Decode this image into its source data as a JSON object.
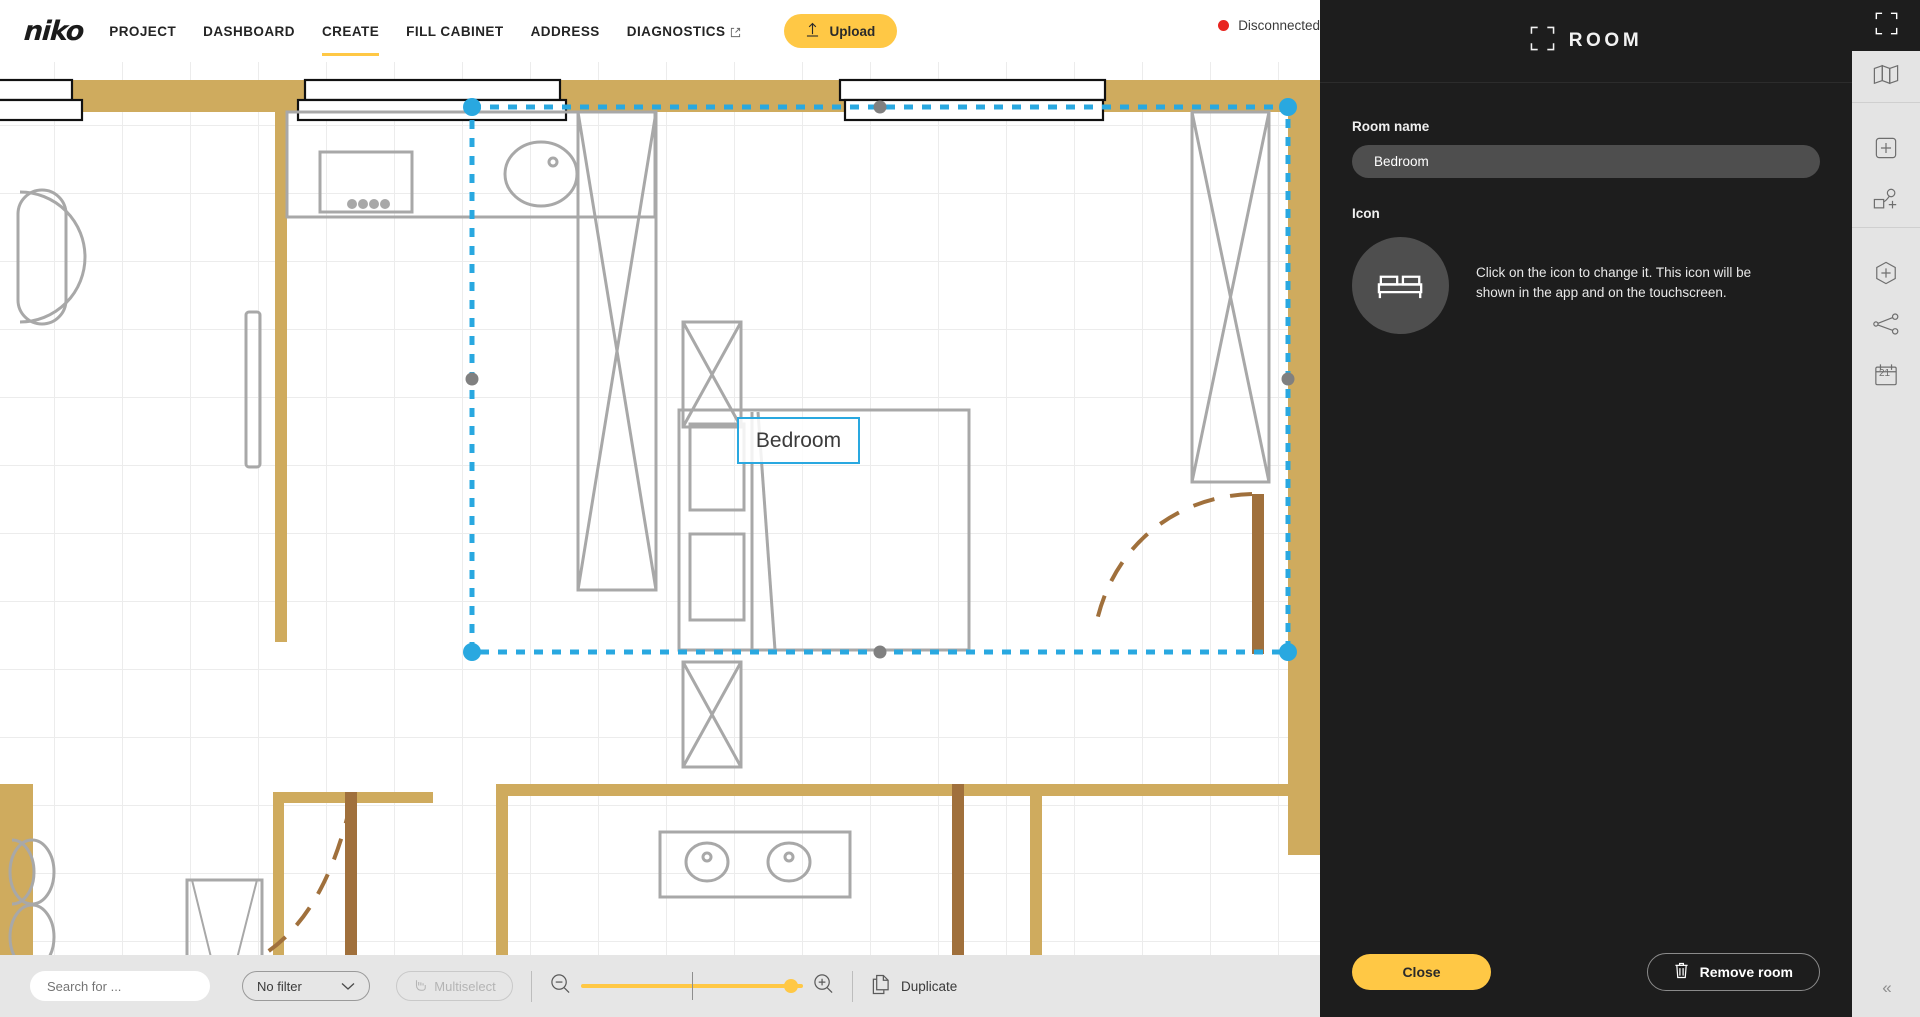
{
  "brand": {
    "logo": "niko"
  },
  "topnav": {
    "items": [
      {
        "label": "PROJECT",
        "active": false,
        "external": false
      },
      {
        "label": "DASHBOARD",
        "active": false,
        "external": false
      },
      {
        "label": "CREATE",
        "active": true,
        "external": false
      },
      {
        "label": "FILL CABINET",
        "active": false,
        "external": false
      },
      {
        "label": "ADDRESS",
        "active": false,
        "external": false
      },
      {
        "label": "DIAGNOSTICS",
        "active": false,
        "external": true
      }
    ],
    "upload_label": "Upload",
    "status_label": "Disconnected",
    "status_color": "#e8241f"
  },
  "canvas": {
    "room_label": "Bedroom",
    "selection_color": "#29a8e0",
    "wall_color": "#cfab5e",
    "door_color": "#a0703c",
    "furniture_color": "#a8a8a8"
  },
  "toolbar": {
    "search_placeholder": "Search for ...",
    "search_value": "",
    "filter_value": "No filter",
    "multiselect_label": "Multiselect",
    "multiselect_disabled": true,
    "zoom_percent": 91,
    "duplicate_label": "Duplicate"
  },
  "panel": {
    "title": "ROOM",
    "room_name_label": "Room name",
    "room_name_value": "Bedroom",
    "icon_label": "Icon",
    "icon_name": "bed-icon",
    "icon_description": "Click on the icon to change it. This icon will be shown in the app and on the touchscreen.",
    "close_label": "Close",
    "remove_label": "Remove room",
    "accent_color": "#ffc845"
  },
  "rail": {
    "items": [
      {
        "name": "room-icon",
        "active": true
      },
      {
        "name": "map-icon",
        "active": false
      },
      {
        "name": "add-square-icon",
        "active": false
      },
      {
        "name": "add-device-icon",
        "active": false
      },
      {
        "name": "add-hexagon-icon",
        "active": false
      },
      {
        "name": "network-share-icon",
        "active": false
      },
      {
        "name": "calendar-icon",
        "active": false
      }
    ],
    "calendar_day": "21",
    "collapse_label": "«"
  }
}
